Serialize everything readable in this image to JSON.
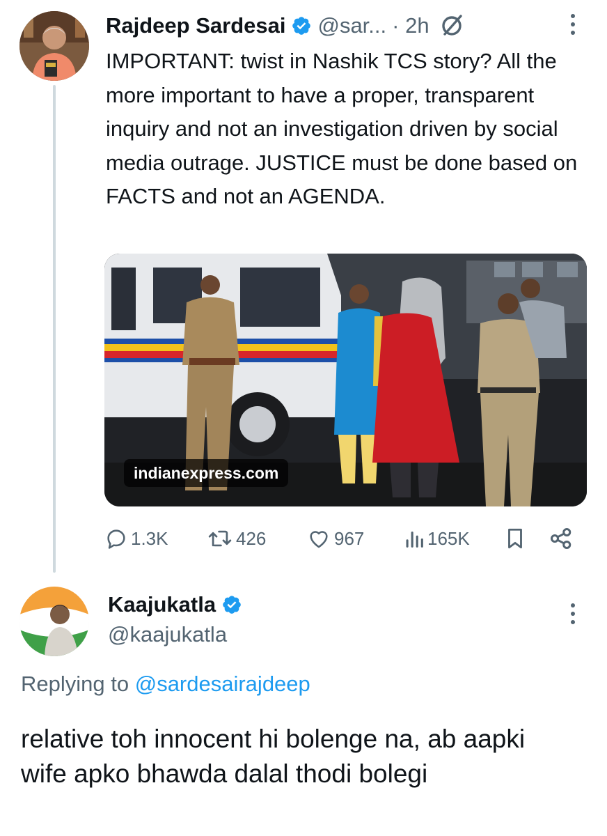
{
  "tweet": {
    "author_name": "Rajdeep Sardesai",
    "author_handle": "@sar...",
    "time": "· 2h",
    "text": "IMPORTANT: twist in Nashik TCS story? All the more important to have a proper, transparent inquiry and not an investigation driven by social media outrage. JUSTICE must be done based on FACTS and not an AGENDA.",
    "media_domain": "indianexpress.com",
    "stats": {
      "replies": "1.3K",
      "reposts": "426",
      "likes": "967",
      "views": "165K"
    }
  },
  "reply": {
    "author_name": "Kaajukatla",
    "author_handle": "@kaajukatla",
    "replying_prefix": "Replying to",
    "replying_to": "@sardesairajdeep",
    "text": "relative toh innocent hi bolenge na, ab aapki wife apko bhawda dalal thodi bolegi"
  },
  "icons": {
    "verified": "verified-badge-icon",
    "grok": "grok-icon",
    "more": "more-icon",
    "reply": "reply-icon",
    "repost": "repost-icon",
    "like": "like-icon",
    "views": "views-icon",
    "bookmark": "bookmark-icon",
    "share": "share-icon"
  },
  "colors": {
    "accent": "#1d9bf0",
    "text": "#0f1419",
    "secondary": "#536471"
  }
}
